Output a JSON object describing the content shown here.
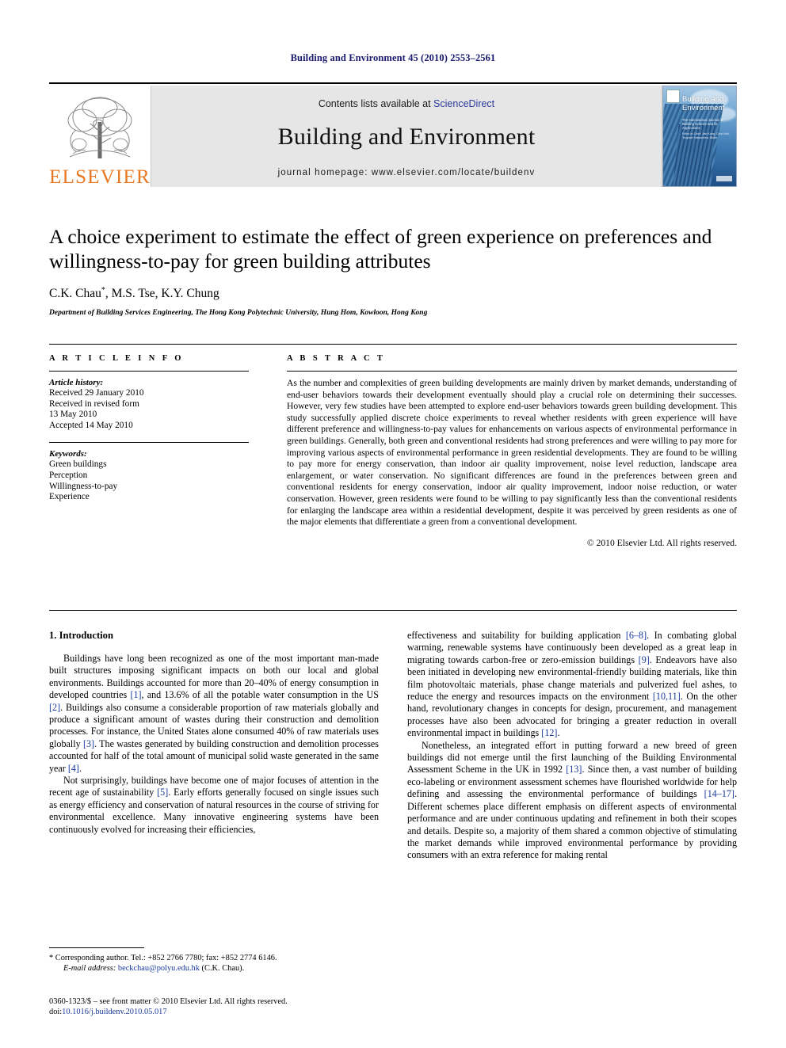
{
  "running_head": "Building and Environment 45 (2010) 2553–2561",
  "masthead": {
    "publisher_name": "ELSEVIER",
    "contents_prefix": "Contents lists available at ",
    "contents_link": "ScienceDirect",
    "journal_title": "Building and Environment",
    "homepage": "journal homepage: www.elsevier.com/locate/buildenv",
    "cover": {
      "title_line1": "Building and",
      "title_line2": "Environment",
      "subtitle": "The International Journal of Building Science and its Applications",
      "editors": "Editor-in-Chief: Jian Kang, Chun Wai, Tsuyoshi Nakashima, Bilder"
    }
  },
  "article": {
    "title": "A choice experiment to estimate the effect of green experience on preferences and willingness-to-pay for green building attributes",
    "authors": "C.K. Chau*, M.S. Tse, K.Y. Chung",
    "affiliation": "Department of Building Services Engineering, The Hong Kong Polytechnic University, Hung Hom, Kowloon, Hong Kong"
  },
  "article_info": {
    "heading": "A R T I C L E    I N F O",
    "history_label": "Article history:",
    "history": [
      "Received 29 January 2010",
      "Received in revised form",
      "13 May 2010",
      "Accepted 14 May 2010"
    ],
    "keywords_label": "Keywords:",
    "keywords": [
      "Green buildings",
      "Perception",
      "Willingness-to-pay",
      "Experience"
    ]
  },
  "abstract": {
    "heading": "A B S T R A C T",
    "text": "As the number and complexities of green building developments are mainly driven by market demands, understanding of end-user behaviors towards their development eventually should play a crucial role on determining their successes. However, very few studies have been attempted to explore end-user behaviors towards green building development. This study successfully applied discrete choice experiments to reveal whether residents with green experience will have different preference and willingness-to-pay values for enhancements on various aspects of environmental performance in green buildings. Generally, both green and conventional residents had strong preferences and were willing to pay more for improving various aspects of environmental performance in green residential developments. They are found to be willing to pay more for energy conservation, than indoor air quality improvement, noise level reduction, landscape area enlargement, or water conservation. No significant differences are found in the preferences between green and conventional residents for energy conservation, indoor air quality improvement, indoor noise reduction, or water conservation. However, green residents were found to be willing to pay significantly less than the conventional residents for enlarging the landscape area within a residential development, despite it was perceived by green residents as one of the major elements that differentiate a green from a conventional development.",
    "copyright": "© 2010 Elsevier Ltd. All rights reserved."
  },
  "body": {
    "section_number_title": "1. Introduction",
    "left_paragraphs": [
      "Buildings have long been recognized as one of the most important man-made built structures imposing significant impacts on both our local and global environments. Buildings accounted for more than 20–40% of energy consumption in developed countries [1], and 13.6% of all the potable water consumption in the US [2]. Buildings also consume a considerable proportion of raw materials globally and produce a significant amount of wastes during their construction and demolition processes. For instance, the United States alone consumed 40% of raw materials uses globally [3]. The wastes generated by building construction and demolition processes accounted for half of the total amount of municipal solid waste generated in the same year [4].",
      "Not surprisingly, buildings have become one of major focuses of attention in the recent age of sustainability [5]. Early efforts generally focused on single issues such as energy efficiency and conservation of natural resources in the course of striving for environmental excellence. Many innovative engineering systems have been continuously evolved for increasing their efficiencies,"
    ],
    "right_paragraphs": [
      "effectiveness and suitability for building application [6–8]. In combating global warming, renewable systems have continuously been developed as a great leap in migrating towards carbon-free or zero-emission buildings [9]. Endeavors have also been initiated in developing new environmental-friendly building materials, like thin film photovoltaic materials, phase change materials and pulverized fuel ashes, to reduce the energy and resources impacts on the environment [10,11]. On the other hand, revolutionary changes in concepts for design, procurement, and management processes have also been advocated for bringing a greater reduction in overall environmental impact in buildings [12].",
      "Nonetheless, an integrated effort in putting forward a new breed of green buildings did not emerge until the first launching of the Building Environmental Assessment Scheme in the UK in 1992 [13]. Since then, a vast number of building eco-labeling or environment assessment schemes have flourished worldwide for help defining and assessing the environmental performance of buildings [14–17]. Different schemes place different emphasis on different aspects of environmental performance and are under continuous updating and refinement in both their scopes and details. Despite so, a majority of them shared a common objective of stimulating the market demands while improved environmental performance by providing consumers with an extra reference for making rental"
    ]
  },
  "footnote": {
    "corresponding": "* Corresponding author. Tel.: +852 2766 7780; fax: +852 2774 6146.",
    "email_label": "E-mail address:",
    "email": "beckchau@polyu.edu.hk",
    "email_suffix": " (C.K. Chau)."
  },
  "issn": {
    "line1": "0360-1323/$ – see front matter © 2010 Elsevier Ltd. All rights reserved.",
    "doi_label": "doi:",
    "doi": "10.1016/j.buildenv.2010.05.017"
  },
  "colors": {
    "running_head": "#1a1a6e",
    "link": "#1a3a9c",
    "elsevier_orange": "#E87722",
    "masthead_bg": "#e6e6e6"
  }
}
